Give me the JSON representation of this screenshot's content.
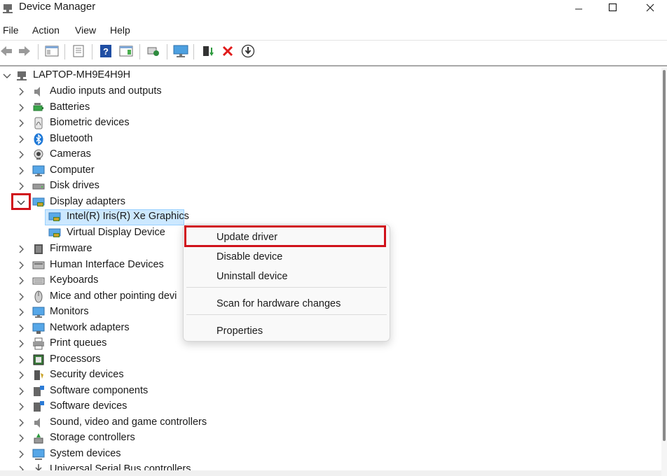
{
  "window": {
    "title": "Device Manager",
    "minimize_glyph": "—",
    "maximize_glyph": "☐",
    "close_glyph": "✕"
  },
  "menu": [
    "File",
    "Action",
    "View",
    "Help"
  ],
  "toolbar": {
    "buttons": [
      "back-icon",
      "forward-icon",
      "show-hide-console-tree-icon",
      "properties-icon",
      "help-icon",
      "action-pane-icon",
      "scan-hardware-icon",
      "monitor-icon",
      "update-driver-icon",
      "uninstall-icon",
      "download-icon"
    ]
  },
  "tree": {
    "root": "LAPTOP-MH9E4H9H",
    "categories": [
      {
        "label": "Audio inputs and outputs",
        "icon": "speaker-icon"
      },
      {
        "label": "Batteries",
        "icon": "battery-icon"
      },
      {
        "label": "Biometric devices",
        "icon": "fingerprint-icon"
      },
      {
        "label": "Bluetooth",
        "icon": "bluetooth-icon"
      },
      {
        "label": "Cameras",
        "icon": "camera-icon"
      },
      {
        "label": "Computer",
        "icon": "computer-icon"
      },
      {
        "label": "Disk drives",
        "icon": "disk-icon"
      },
      {
        "label": "Display adapters",
        "icon": "display-adapter-icon",
        "expanded": true
      },
      {
        "label": "Firmware",
        "icon": "firmware-icon"
      },
      {
        "label": "Human Interface Devices",
        "icon": "hid-icon"
      },
      {
        "label": "Keyboards",
        "icon": "keyboard-icon"
      },
      {
        "label": "Mice and other pointing devi",
        "icon": "mouse-icon"
      },
      {
        "label": "Monitors",
        "icon": "monitor-icon"
      },
      {
        "label": "Network adapters",
        "icon": "network-icon"
      },
      {
        "label": "Print queues",
        "icon": "printer-icon"
      },
      {
        "label": "Processors",
        "icon": "processor-icon"
      },
      {
        "label": "Security devices",
        "icon": "security-icon"
      },
      {
        "label": "Software components",
        "icon": "software-component-icon"
      },
      {
        "label": "Software devices",
        "icon": "software-device-icon"
      },
      {
        "label": "Sound, video and game controllers",
        "icon": "sound-icon"
      },
      {
        "label": "Storage controllers",
        "icon": "storage-icon"
      },
      {
        "label": "System devices",
        "icon": "system-icon"
      },
      {
        "label": "Universal Serial Bus controllers",
        "icon": "usb-icon"
      }
    ],
    "display_children": [
      "Intel(R) Iris(R) Xe Graphics",
      "Virtual Display Device"
    ]
  },
  "context_menu": {
    "items": [
      "Update driver",
      "Disable device",
      "Uninstall device",
      "Scan for hardware changes",
      "Properties"
    ]
  },
  "colors": {
    "highlight_red": "#d0121b",
    "selection_bg": "#cce8ff"
  }
}
